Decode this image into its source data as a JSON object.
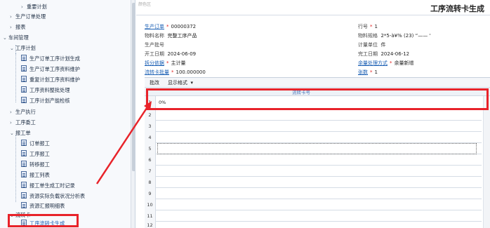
{
  "sidebar": {
    "items": [
      {
        "label": "重要计划",
        "kind": "folder",
        "expanded": false
      },
      {
        "label": "生产订单处理",
        "kind": "folder",
        "expanded": false
      },
      {
        "label": "报表",
        "kind": "folder",
        "expanded": false
      },
      {
        "label": "车间管理",
        "kind": "folder",
        "expanded": true
      },
      {
        "label": "工序计划",
        "kind": "folder",
        "expanded": true
      },
      {
        "label": "生产订单工序计划生成",
        "kind": "doc"
      },
      {
        "label": "生产订单工序资料维护",
        "kind": "doc"
      },
      {
        "label": "重复计划工序资料维护",
        "kind": "doc"
      },
      {
        "label": "工序资料整批处理",
        "kind": "doc"
      },
      {
        "label": "工序计划产能检核",
        "kind": "doc"
      },
      {
        "label": "生产执行",
        "kind": "folder",
        "expanded": false
      },
      {
        "label": "工序委工",
        "kind": "folder",
        "expanded": false
      },
      {
        "label": "报工单",
        "kind": "folder",
        "expanded": true
      },
      {
        "label": "订单报工",
        "kind": "doc"
      },
      {
        "label": "工序报工",
        "kind": "doc"
      },
      {
        "label": "转移报工",
        "kind": "doc"
      },
      {
        "label": "报工列表",
        "kind": "doc"
      },
      {
        "label": "报工单生成工时记录",
        "kind": "doc"
      },
      {
        "label": "资源实际负载状况分析表",
        "kind": "doc"
      },
      {
        "label": "资源汇报明细表",
        "kind": "doc"
      },
      {
        "label": "流转卡",
        "kind": "folder",
        "expanded": true
      },
      {
        "label": "工序流转卡生成",
        "kind": "doc",
        "selected": true
      }
    ]
  },
  "main": {
    "ghost_text": "颜色区",
    "title": "工序流转卡生成",
    "form": {
      "order_no": {
        "label": "生产订单",
        "value": "00000372",
        "required": true,
        "link": true
      },
      "line_no": {
        "label": "行号",
        "value": "1",
        "required": true,
        "link": false
      },
      "material_name": {
        "label": "物料名称",
        "value": "完整工序产品",
        "required": false,
        "link": false
      },
      "material_spec": {
        "label": "物料规格",
        "value": "2*5-à¥% (23) “—— ‘",
        "required": false,
        "link": false
      },
      "batch_no": {
        "label": "生产批号",
        "value": "",
        "required": false,
        "link": false
      },
      "unit": {
        "label": "计量单位",
        "value": "件",
        "required": false,
        "link": false
      },
      "start_date": {
        "label": "开工日期",
        "value": "2024-06-09",
        "required": false,
        "link": false
      },
      "end_date": {
        "label": "完工日期",
        "value": "2024-06-12",
        "required": false,
        "link": false
      },
      "split_basis": {
        "label": "拆分依据",
        "value": "主计量",
        "required": true,
        "link": true
      },
      "remainder_method": {
        "label": "余量处理方式",
        "value": "余量新增",
        "required": true,
        "link": true
      },
      "card_qty": {
        "label": "流转卡批量",
        "value": "100.000000",
        "required": true,
        "link": true
      },
      "sheets": {
        "label": "张数",
        "value": "1",
        "required": true,
        "link": true
      }
    },
    "toolbar": {
      "batch_change": "批改",
      "display_format": "显示格式",
      "dropdown_arrow": "▾"
    },
    "grid": {
      "header": "流转卡号",
      "rows": [
        {
          "num": "1",
          "value": "0%"
        },
        {
          "num": "2",
          "value": ""
        },
        {
          "num": "3",
          "value": ""
        },
        {
          "num": "4",
          "value": ""
        },
        {
          "num": "5",
          "value": ""
        },
        {
          "num": "6",
          "value": ""
        },
        {
          "num": "7",
          "value": ""
        },
        {
          "num": "8",
          "value": ""
        },
        {
          "num": "9",
          "value": ""
        },
        {
          "num": "10",
          "value": ""
        },
        {
          "num": "11",
          "value": ""
        },
        {
          "num": "12",
          "value": ""
        }
      ]
    }
  },
  "colors": {
    "annotation": "#e8232a",
    "link": "#1a5fb4",
    "required": "#e02020"
  }
}
